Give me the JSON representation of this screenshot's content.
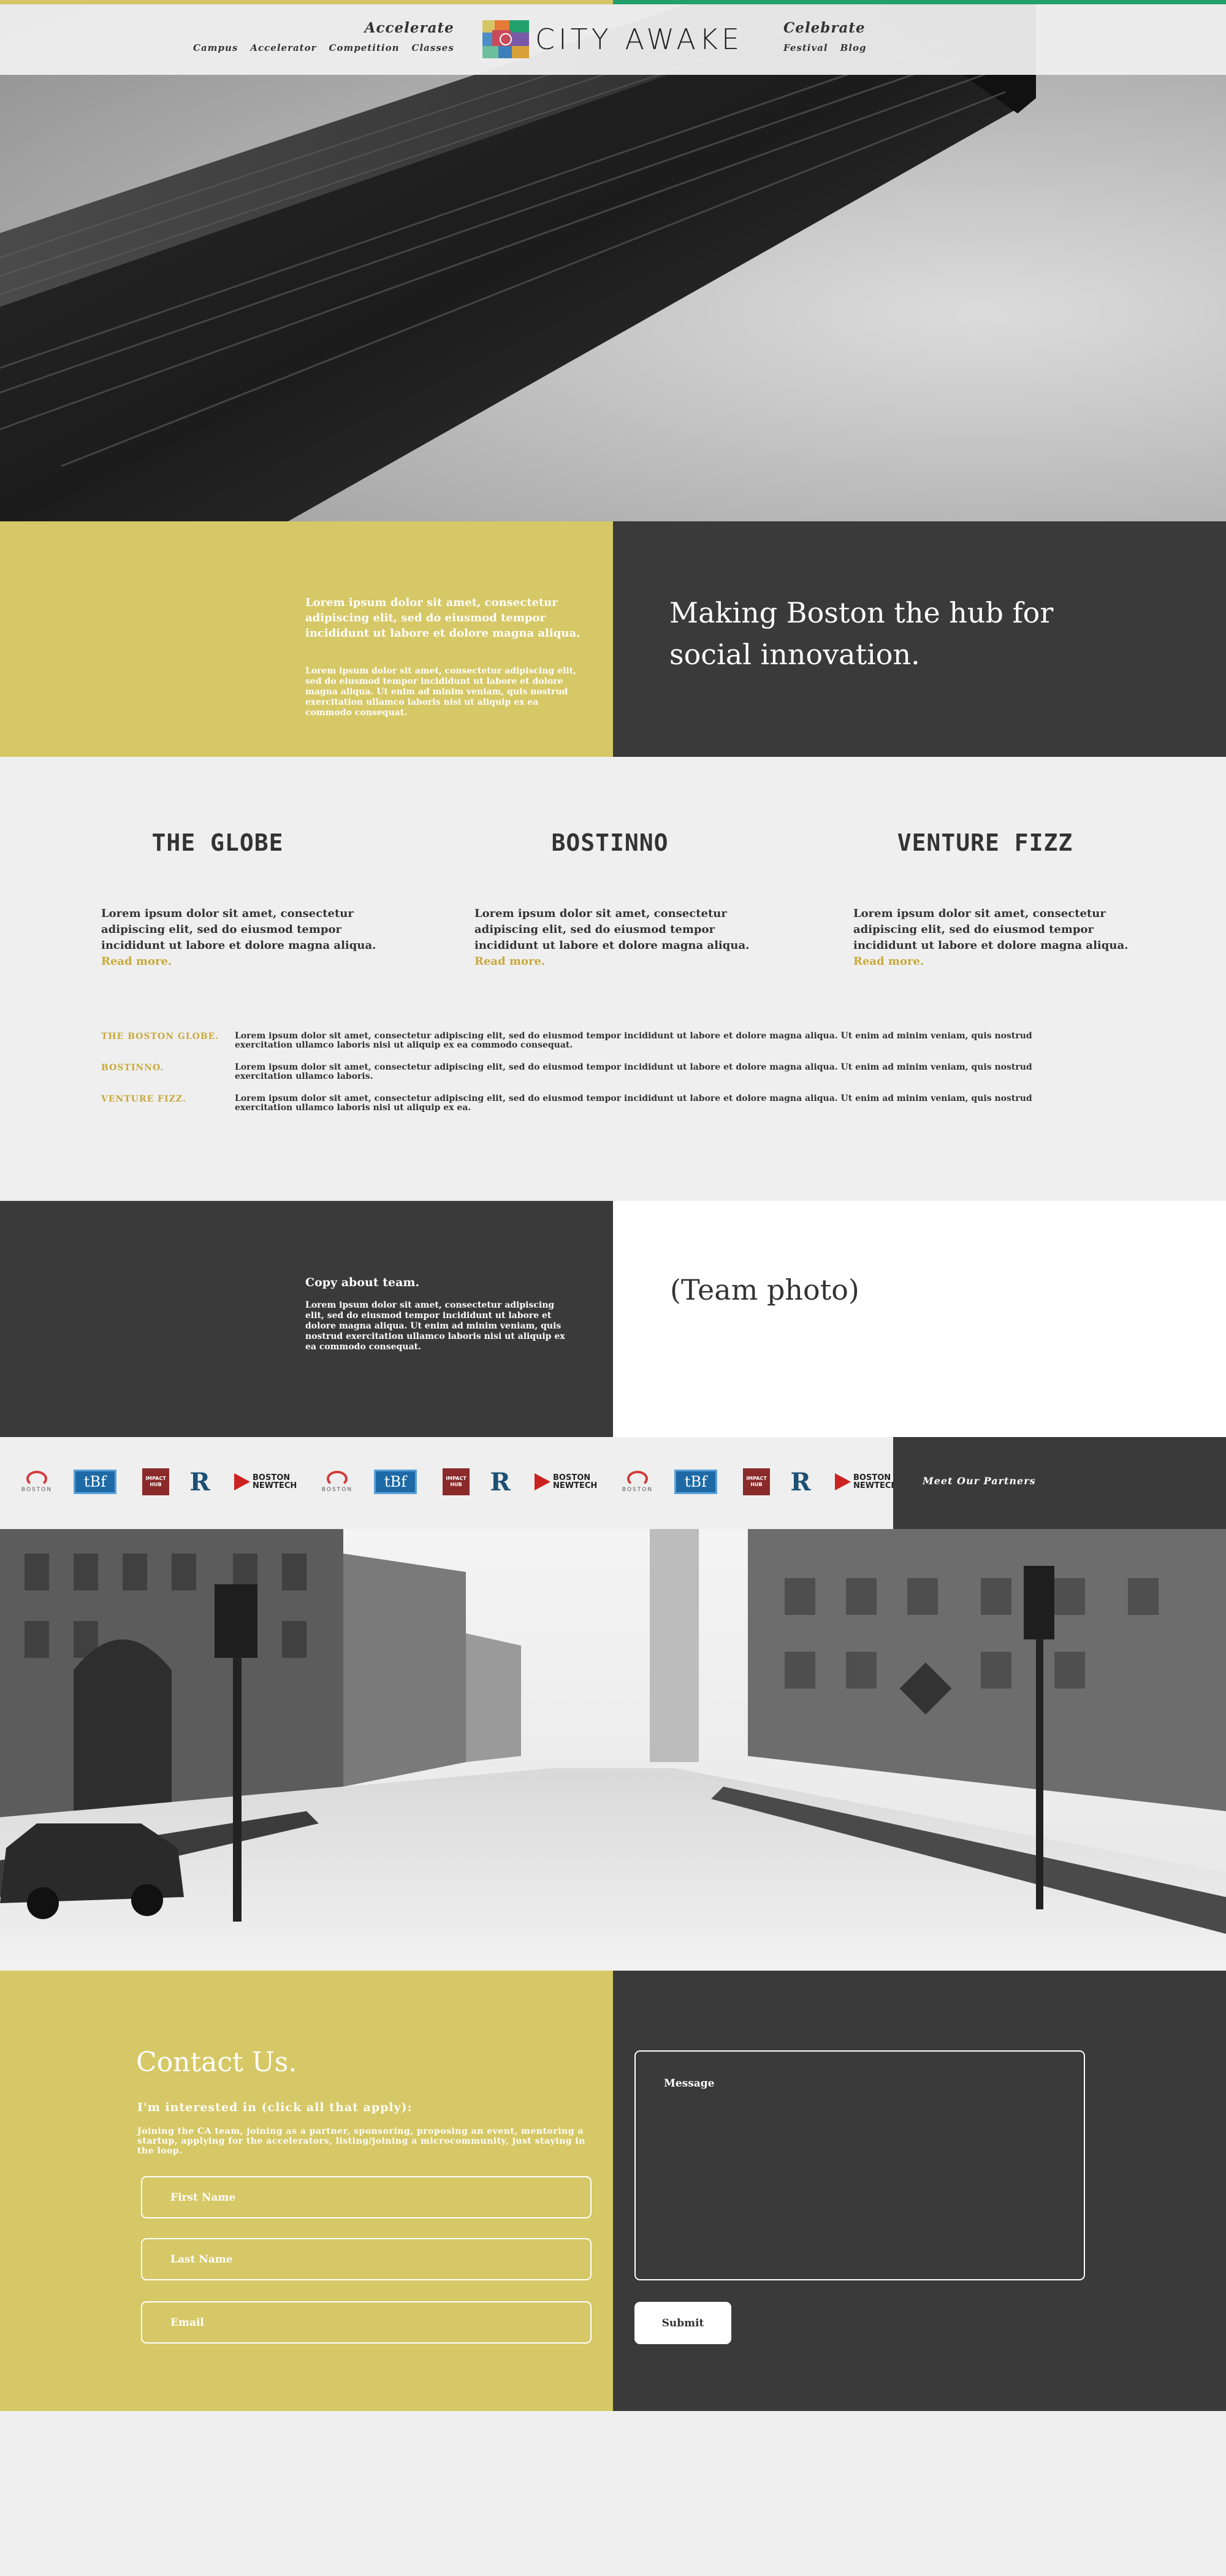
{
  "header": {
    "left_nav": {
      "heading": "Accelerate",
      "links": [
        "Campus",
        "Accelerator",
        "Competition",
        "Classes"
      ]
    },
    "logo_text": "CITY AWAKE",
    "right_nav": {
      "heading": "Celebrate",
      "links": [
        "Festival",
        "Blog"
      ]
    },
    "colors": {
      "left_bar": "#d6c565",
      "right_bar": "#22a06b"
    }
  },
  "mission": {
    "lead": "Lorem ipsum dolor sit amet, consectetur adipiscing elit, sed do eiusmod tempor incididunt ut labore et dolore magna aliqua.",
    "body": "Lorem ipsum dolor sit amet, consectetur adipiscing elit, sed do eiusmod tempor incididunt ut labore et dolore magna aliqua. Ut enim ad minim veniam, quis nostrud exercitation ullamco laboris nisi ut aliquip ex ea commodo consequat.",
    "tagline": "Making Boston the hub for social innovation."
  },
  "press": {
    "columns": [
      {
        "name": "THE GLOBE",
        "text": "Lorem ipsum dolor sit amet, consectetur adipiscing elit, sed do eiusmod tempor incididunt ut labore et dolore magna aliqua.",
        "link": "Read more."
      },
      {
        "name": "BOSTINNO",
        "text": "Lorem ipsum dolor sit amet, consectetur adipiscing elit, sed do eiusmod tempor incididunt ut labore et dolore magna aliqua.",
        "link": "Read more."
      },
      {
        "name": "VENTURE FIZZ",
        "text": "Lorem ipsum dolor sit amet, consectetur adipiscing elit, sed do eiusmod tempor incididunt ut labore et dolore magna aliqua.",
        "link": "Read more."
      }
    ],
    "quotes": [
      {
        "source": "THE BOSTON GLOBE.",
        "text": "Lorem ipsum dolor sit amet, consectetur adipiscing elit, sed do eiusmod tempor incididunt ut labore et dolore magna aliqua. Ut enim ad minim veniam, quis nostrud exercitation ullamco laboris nisi ut aliquip ex ea commodo consequat."
      },
      {
        "source": "BOSTINNO.",
        "text": "Lorem ipsum dolor sit amet, consectetur adipiscing elit, sed do eiusmod tempor incididunt ut labore et dolore magna aliqua. Ut enim ad minim veniam, quis nostrud exercitation ullamco laboris."
      },
      {
        "source": "VENTURE FIZZ.",
        "text": "Lorem ipsum dolor sit amet, consectetur adipiscing elit, sed do eiusmod tempor incididunt ut labore et dolore magna aliqua. Ut enim ad minim veniam, quis nostrud exercitation ullamco laboris nisi ut aliquip ex ea."
      }
    ]
  },
  "team": {
    "heading": "Copy about team.",
    "body": "Lorem ipsum dolor sit amet, consectetur adipiscing elit, sed do eiusmod tempor incididunt ut labore et dolore magna aliqua. Ut enim ad minim veniam, quis nostrud exercitation ullamco laboris nisi ut aliquip ex ea commodo consequat.",
    "photo_placeholder": "(Team photo)"
  },
  "partners": {
    "cta": "Meet Our Partners",
    "logos": [
      {
        "icon": "spiral-logo",
        "label": "BOSTON"
      },
      {
        "icon": "tbf-logo",
        "label": "tBf"
      },
      {
        "icon": "impact-hub-logo",
        "label": "IMPACT HUB"
      },
      {
        "icon": "r-logo",
        "label": "R"
      },
      {
        "icon": "boston-newtech-logo",
        "label": "BOSTON NEWTECH"
      }
    ]
  },
  "contact": {
    "title": "Contact Us.",
    "subtitle": "I'm interested in (click all that apply):",
    "description": "Joining the CA team, joining as a partner, sponsoring, proposing an event, mentoring a startup, applying for the accelerators, listing/joining a microcommunity, just staying in the loop.",
    "first_name_placeholder": "First Name",
    "last_name_placeholder": "Last Name",
    "email_placeholder": "Email",
    "message_placeholder": "Message",
    "submit_label": "Submit"
  }
}
